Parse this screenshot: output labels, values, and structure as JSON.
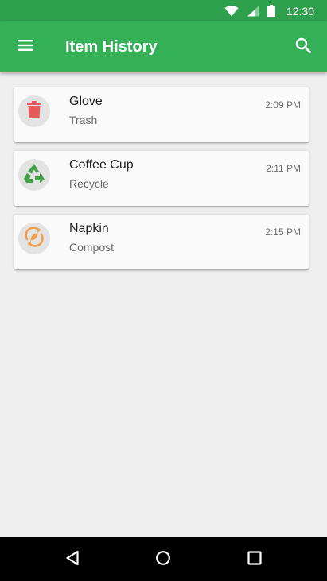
{
  "status_bar": {
    "time": "12:30",
    "icons": [
      "wifi-icon",
      "signal-icon",
      "battery-icon"
    ]
  },
  "app_bar": {
    "title": "Item History",
    "menu_icon": "menu-icon",
    "search_icon": "search-icon",
    "background": "#34b057",
    "status_background": "#2e9f4c"
  },
  "history": {
    "items": [
      {
        "name": "Glove",
        "category": "Trash",
        "time": "2:09 PM",
        "icon": "trash-can-icon",
        "color": "#e85a5a"
      },
      {
        "name": "Coffee Cup",
        "category": "Recycle",
        "time": "2:11 PM",
        "icon": "recycle-icon",
        "color": "#43a047"
      },
      {
        "name": "Napkin",
        "category": "Compost",
        "time": "2:15 PM",
        "icon": "compost-icon",
        "color": "#f0a04b"
      }
    ]
  },
  "nav_bar": {
    "icons": [
      "back-icon",
      "home-icon",
      "recents-icon"
    ]
  }
}
